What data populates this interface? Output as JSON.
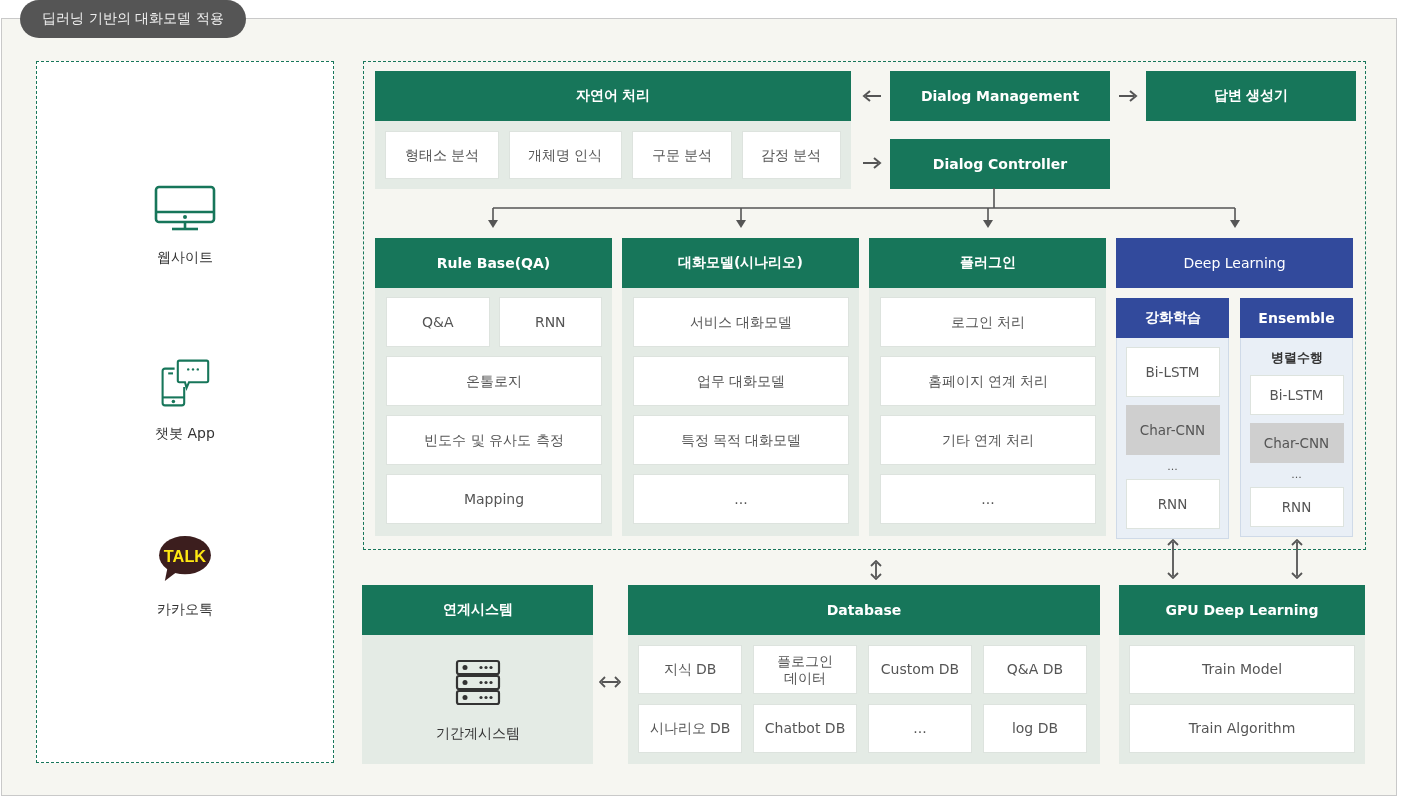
{
  "title": "딥러닝 기반의 대화모델 적용",
  "channels": [
    {
      "kind": "monitor",
      "label": "웹사이트"
    },
    {
      "kind": "chat",
      "label": "챗봇 App"
    },
    {
      "kind": "talk",
      "label": "카카오톡",
      "icon_text": "TALK"
    }
  ],
  "nlp": {
    "title": "자연어 처리",
    "items": [
      "형태소 분석",
      "개체명 인식",
      "구문 분석",
      "감정 분석"
    ]
  },
  "dialog_management": "Dialog Management",
  "answer_generator": "답변 생성기",
  "dialog_controller": "Dialog Controller",
  "modules": [
    {
      "title": "Rule Base(QA)",
      "rows": [
        [
          "Q&A",
          "RNN"
        ],
        [
          "온톨로지"
        ],
        [
          "빈도수 및 유사도 측정"
        ],
        [
          "Mapping"
        ]
      ]
    },
    {
      "title": "대화모델(시나리오)",
      "rows": [
        [
          "서비스 대화모델"
        ],
        [
          "업무 대화모델"
        ],
        [
          "특정 목적 대화모델"
        ],
        [
          "..."
        ]
      ]
    },
    {
      "title": "플러그인",
      "rows": [
        [
          "로그인 처리"
        ],
        [
          "홈페이지 연계 처리"
        ],
        [
          "기타 연계 처리"
        ],
        [
          "..."
        ]
      ]
    }
  ],
  "deep_learning": {
    "title": "Deep Learning",
    "groups": [
      {
        "title": "강화학습",
        "items": [
          {
            "kind": "model",
            "label": "Bi-LSTM",
            "highlighted": false
          },
          {
            "kind": "model",
            "label": "Char-CNN",
            "highlighted": true
          },
          {
            "kind": "ellipsis",
            "label": "..."
          },
          {
            "kind": "model",
            "label": "RNN",
            "highlighted": false
          }
        ]
      },
      {
        "title": "Ensemble",
        "subtitle": "병렬수행",
        "items": [
          {
            "kind": "model",
            "label": "Bi-LSTM",
            "highlighted": false
          },
          {
            "kind": "model",
            "label": "Char-CNN",
            "highlighted": true
          },
          {
            "kind": "ellipsis",
            "label": "..."
          },
          {
            "kind": "model",
            "label": "RNN",
            "highlighted": false
          }
        ]
      }
    ]
  },
  "linked_system": {
    "title": "연계시스템",
    "label": "기간계시스템"
  },
  "database": {
    "title": "Database",
    "items": [
      "지식 DB",
      "플로그인 데이터",
      "Custom DB",
      "Q&A DB",
      "시나리오 DB",
      "Chatbot DB",
      "...",
      "log DB"
    ]
  },
  "gpu": {
    "title": "GPU Deep Learning",
    "items": [
      "Train Model",
      "Train Algorithm"
    ]
  }
}
